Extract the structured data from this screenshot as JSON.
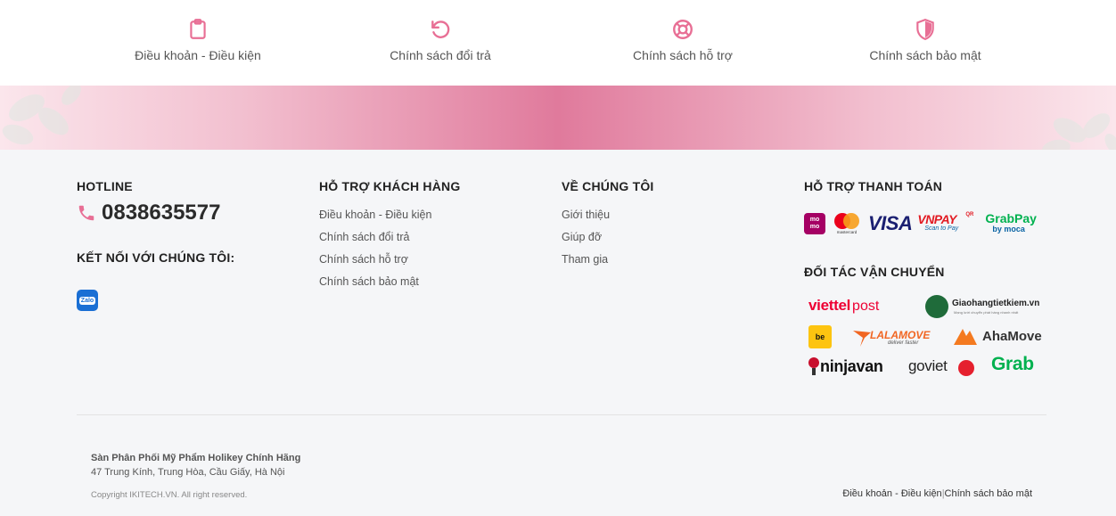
{
  "policies": [
    {
      "label": "Điều khoản - Điều kiện",
      "icon": "clipboard-icon"
    },
    {
      "label": "Chính sách đổi trả",
      "icon": "undo-icon"
    },
    {
      "label": "Chính sách hỗ trợ",
      "icon": "lifebuoy-icon"
    },
    {
      "label": "Chính sách bảo mật",
      "icon": "shield-icon"
    }
  ],
  "colors": {
    "accent": "#e07a9c",
    "icon": "#e86f95"
  },
  "hotline": {
    "title": "HOTLINE",
    "number": "0838635577"
  },
  "connect": {
    "title": "KẾT NỐI VỚI CHÚNG TÔI:",
    "zalo": "Zalo"
  },
  "support": {
    "title": "HỖ TRỢ KHÁCH HÀNG",
    "items": [
      "Điều khoản - Điều kiện",
      "Chính sách đổi trả",
      "Chính sách hỗ trợ",
      "Chính sách bảo mật"
    ]
  },
  "about": {
    "title": "VỀ CHÚNG TÔI",
    "items": [
      "Giới thiệu",
      "Giúp đỡ",
      "Tham gia"
    ]
  },
  "payment": {
    "title": "HỖ TRỢ THANH TOÁN",
    "logos": {
      "momo": "mo mo",
      "mastercard": "mastercard",
      "visa": "VISA",
      "vnpay": "VNPAY",
      "vnpay_qr": "QR",
      "vnpay_sub": "Scan to Pay",
      "grabpay": "GrabPay",
      "grabpay_sub": "by moca"
    }
  },
  "shipping": {
    "title": "ĐỐI TÁC VẬN CHUYỂN",
    "logos": {
      "viettel": "viettel",
      "viettel_post": "post",
      "ghtk": "Giaohangtietkiem.vn",
      "ghtk_sub": "Mạng lưới chuyển phát hàng nhanh nhất",
      "be": "be",
      "lalamove": "LALAMOVE",
      "lalamove_sub": "deliver faster",
      "ahamove": "AhaMove",
      "ninjavan": "ninjavan",
      "goviet": "goviet",
      "grab": "Grab"
    }
  },
  "company": {
    "name": "Sàn Phân Phối Mỹ Phẩm Holikey Chính Hãng",
    "address": "47 Trung Kính, Trung Hòa, Cầu Giấy, Hà Nội",
    "copyright": "Copyright IKITECH.VN. All right reserved."
  },
  "bottom_links": {
    "terms": "Điều khoản - Điều kiện",
    "separator": "|",
    "privacy": "Chính sách bảo mật"
  }
}
